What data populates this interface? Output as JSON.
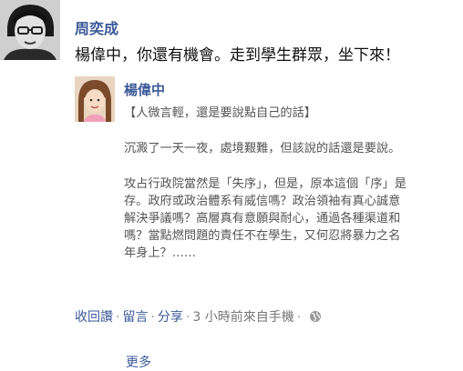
{
  "post": {
    "author": "周奕成",
    "status": "楊偉中，你還有機會。走到學生群眾，坐下來！"
  },
  "shared": {
    "author": "楊偉中",
    "lines": [
      "【人微言輕，還是要說點自己的話】",
      "",
      "沉澱了一天一夜，處境艱難，但該說的話還是要說。",
      "",
      "攻占行政院當然是「失序」，但是，原本這個「序」是",
      "存。政府或政治體系有威信嗎？政治領袖有真心誠意",
      "解決爭議嗎？高層真有意願與耐心，通過各種渠道和",
      "嗎？當點燃問題的責任不在學生，又何忍將暴力之名",
      "年身上？……"
    ],
    "more": "更多"
  },
  "actions": {
    "collect": "收回讚",
    "comment": "留言",
    "share": "分享",
    "time": "3 小時前來自手機",
    "globe_icon": "globe-icon"
  },
  "colors": {
    "link": "#3b5998",
    "text": "#333333",
    "muted": "#777777"
  }
}
